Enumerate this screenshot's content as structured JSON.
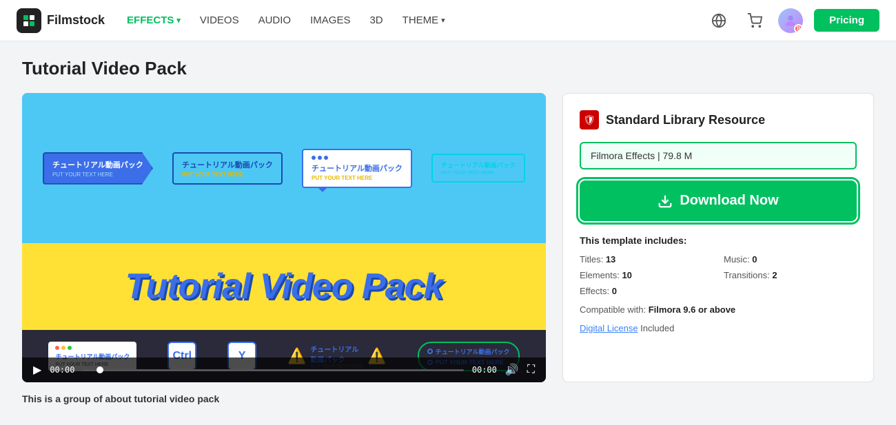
{
  "brand": {
    "logo_text": "Filmstock",
    "logo_initial": "F"
  },
  "navbar": {
    "effects_label": "EFFECTS",
    "videos_label": "VIDEOS",
    "audio_label": "AUDIO",
    "images_label": "IMAGES",
    "three_d_label": "3D",
    "theme_label": "THEME",
    "pricing_label": "Pricing"
  },
  "page": {
    "title": "Tutorial Video Pack"
  },
  "video": {
    "big_title": "Tutorial Video Pack",
    "time_start": "00:00",
    "time_end": "00:00",
    "jp_text": "チュートリアル動画パック",
    "en_text": "PUT YOUR TEXT HERE"
  },
  "sidebar": {
    "resource_label": "Standard Library Resource",
    "file_label": "Filmora Effects | 79.8 M",
    "download_label": "Download Now",
    "template_includes_label": "This template includes:",
    "titles_label": "Titles:",
    "titles_value": "13",
    "music_label": "Music:",
    "music_value": "0",
    "elements_label": "Elements:",
    "elements_value": "10",
    "transitions_label": "Transitions:",
    "transitions_value": "2",
    "effects_label": "Effects:",
    "effects_value": "0",
    "compatible_label": "Compatible with:",
    "compatible_value": "Filmora 9.6 or above",
    "license_label": "Digital License",
    "license_suffix": " Included"
  },
  "description": {
    "text": "This is a group of about tutorial video pack"
  }
}
